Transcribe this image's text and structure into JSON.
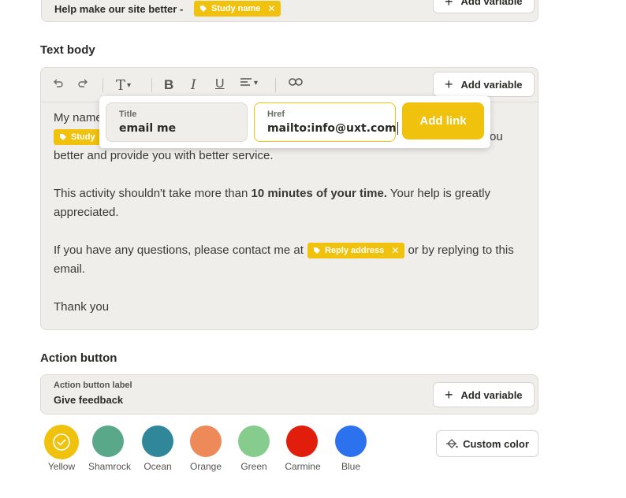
{
  "subject": {
    "text": "Help make our site better -",
    "tag": "Study name",
    "add_variable": "Add variable"
  },
  "text_body": {
    "title": "Text body",
    "add_variable": "Add variable",
    "line1_start": "My name",
    "line1_tag": "Study",
    "line1_end": "ou",
    "line2": "better and provide you with better service.",
    "para2_a": "This activity shouldn't take more than ",
    "para2_bold": "10 minutes of your time.",
    "para2_b": " Your help is greatly",
    "para2_c": "appreciated.",
    "para3_a": "If you have any questions, please contact me at",
    "para3_tag": "Reply address",
    "para3_b": " or by replying to this",
    "para3_c": "email.",
    "para4": "Thank you"
  },
  "link_popup": {
    "title_label": "Title",
    "title_value": "email me",
    "href_label": "Href",
    "href_value": "mailto:info@uxt.com",
    "add_link": "Add link"
  },
  "action_button": {
    "title": "Action button",
    "label": "Action button label",
    "value": "Give feedback",
    "add_variable": "Add variable"
  },
  "colors": {
    "swatches": [
      {
        "name": "Yellow",
        "hex": "#f0c20e",
        "selected": true
      },
      {
        "name": "Shamrock",
        "hex": "#5aa88a"
      },
      {
        "name": "Ocean",
        "hex": "#2f8799"
      },
      {
        "name": "Orange",
        "hex": "#ee8a5a"
      },
      {
        "name": "Green",
        "hex": "#86cc8c"
      },
      {
        "name": "Carmine",
        "hex": "#e11d0b"
      },
      {
        "name": "Blue",
        "hex": "#2c72ee"
      }
    ],
    "custom": "Custom color"
  }
}
